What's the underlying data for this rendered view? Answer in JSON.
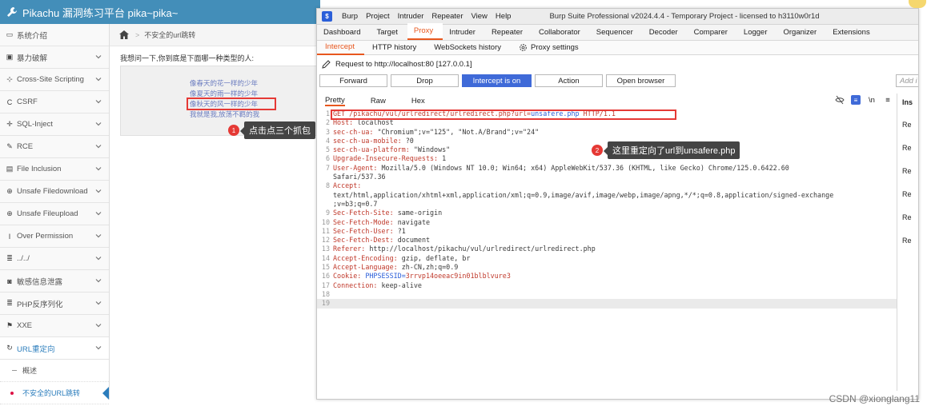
{
  "pikachu": {
    "app_title": "Pikachu 漏洞练习平台 pika~pika~",
    "breadcrumb": "不安全的url跳转",
    "question": "我想问一下,你到底是下面哪一种类型的人:",
    "links": [
      "像春天的花一样的少年",
      "像夏天的雨一样的少年",
      "像秋天的风一样的少年",
      "我就是我,放荡不羁的我"
    ],
    "sidebar": [
      {
        "label": "系统介绍",
        "icon": "desktop-icon"
      },
      {
        "label": "暴力破解",
        "icon": "lock-icon"
      },
      {
        "label": "Cross-Site Scripting",
        "icon": "code-icon"
      },
      {
        "label": "CSRF",
        "icon": "csrf-icon"
      },
      {
        "label": "SQL-Inject",
        "icon": "syringe-icon"
      },
      {
        "label": "RCE",
        "icon": "pencil-icon"
      },
      {
        "label": "File Inclusion",
        "icon": "file-icon"
      },
      {
        "label": "Unsafe Filedownload",
        "icon": "download-icon"
      },
      {
        "label": "Unsafe Fileupload",
        "icon": "upload-icon"
      },
      {
        "label": "Over Permission",
        "icon": "cursor-icon"
      },
      {
        "label": "../../",
        "icon": "list-icon"
      },
      {
        "label": "敏感信息泄露",
        "icon": "camera-icon"
      },
      {
        "label": "PHP反序列化",
        "icon": "list-icon"
      },
      {
        "label": "XXE",
        "icon": "flag-icon"
      },
      {
        "label": "URL重定向",
        "icon": "redirect-icon"
      }
    ],
    "sub_items": [
      "概述",
      "不安全的URL跳转"
    ]
  },
  "callouts": {
    "one_num": "1",
    "one_text": "点击点三个抓包",
    "two_num": "2",
    "two_text": "这里重定向了url到unsafere.php"
  },
  "burp": {
    "menu": [
      "Burp",
      "Project",
      "Intruder",
      "Repeater",
      "View",
      "Help"
    ],
    "window_title": "Burp Suite Professional v2024.4.4 - Temporary Project - licensed to h3110w0r1d",
    "main_tabs": [
      "Dashboard",
      "Target",
      "Proxy",
      "Intruder",
      "Repeater",
      "Collaborator",
      "Sequencer",
      "Decoder",
      "Comparer",
      "Logger",
      "Organizer",
      "Extensions"
    ],
    "selected_main_tab": "Proxy",
    "sub_tabs": [
      "Intercept",
      "HTTP history",
      "WebSockets history",
      "Proxy settings"
    ],
    "request_line": "Request to http://localhost:80  [127.0.0.1]",
    "buttons": {
      "forward": "Forward",
      "drop": "Drop",
      "intercept": "Intercept is on",
      "action": "Action",
      "open_browser": "Open browser",
      "add": "Add i"
    },
    "views": [
      "Pretty",
      "Raw",
      "Hex"
    ],
    "inspector_title": "Ins",
    "inspector_rows": [
      "Re",
      "Re",
      "Re",
      "Re",
      "Re",
      "Re"
    ],
    "request_lines": [
      {
        "n": "1",
        "parts": [
          [
            "GET /pikachu/vul/urlredirect/urlredirect.php?url=",
            "h"
          ],
          [
            "unsafere.php",
            "b"
          ],
          [
            " HTTP/1.1",
            "h"
          ]
        ]
      },
      {
        "n": "2",
        "parts": [
          [
            "Host: ",
            "h"
          ],
          [
            "localhost",
            "v"
          ]
        ]
      },
      {
        "n": "3",
        "parts": [
          [
            "sec-ch-ua: ",
            "h"
          ],
          [
            "\"Chromium\";v=\"125\", \"Not.A/Brand\";v=\"24\"",
            "v"
          ]
        ]
      },
      {
        "n": "4",
        "parts": [
          [
            "sec-ch-ua-mobile: ",
            "h"
          ],
          [
            "?0",
            "v"
          ]
        ]
      },
      {
        "n": "5",
        "parts": [
          [
            "sec-ch-ua-platform: ",
            "h"
          ],
          [
            "\"Windows\"",
            "v"
          ]
        ]
      },
      {
        "n": "6",
        "parts": [
          [
            "Upgrade-Insecure-Requests: ",
            "h"
          ],
          [
            "1",
            "v"
          ]
        ]
      },
      {
        "n": "7",
        "parts": [
          [
            "User-Agent: ",
            "h"
          ],
          [
            "Mozilla/5.0 (Windows NT 10.0; Win64; x64) AppleWebKit/537.36 (KHTML, like Gecko) Chrome/125.0.6422.60",
            "v"
          ]
        ]
      },
      {
        "n": "",
        "parts": [
          [
            "Safari/537.36",
            "v"
          ]
        ]
      },
      {
        "n": "8",
        "parts": [
          [
            "Accept:",
            "h"
          ]
        ]
      },
      {
        "n": "",
        "parts": [
          [
            "text/html,application/xhtml+xml,application/xml;q=0.9,image/avif,image/webp,image/apng,*/*;q=0.8,application/signed-exchange",
            "v"
          ]
        ]
      },
      {
        "n": "",
        "parts": [
          [
            ";v=b3;q=0.7",
            "v"
          ]
        ]
      },
      {
        "n": "9",
        "parts": [
          [
            "Sec-Fetch-Site: ",
            "h"
          ],
          [
            "same-origin",
            "v"
          ]
        ]
      },
      {
        "n": "10",
        "parts": [
          [
            "Sec-Fetch-Mode: ",
            "h"
          ],
          [
            "navigate",
            "v"
          ]
        ]
      },
      {
        "n": "11",
        "parts": [
          [
            "Sec-Fetch-User: ",
            "h"
          ],
          [
            "?1",
            "v"
          ]
        ]
      },
      {
        "n": "12",
        "parts": [
          [
            "Sec-Fetch-Dest: ",
            "h"
          ],
          [
            "document",
            "v"
          ]
        ]
      },
      {
        "n": "13",
        "parts": [
          [
            "Referer: ",
            "h"
          ],
          [
            "http://localhost/pikachu/vul/urlredirect/urlredirect.php",
            "v"
          ]
        ]
      },
      {
        "n": "14",
        "parts": [
          [
            "Accept-Encoding: ",
            "h"
          ],
          [
            "gzip, deflate, br",
            "v"
          ]
        ]
      },
      {
        "n": "15",
        "parts": [
          [
            "Accept-Language: ",
            "h"
          ],
          [
            "zh-CN,zh;q=0.9",
            "v"
          ]
        ]
      },
      {
        "n": "16",
        "parts": [
          [
            "Cookie: ",
            "h"
          ],
          [
            "PHPSESSID=",
            "b"
          ],
          [
            "3rrvp14oeeac9in01blblvure3",
            "r"
          ]
        ]
      },
      {
        "n": "17",
        "parts": [
          [
            "Connection: ",
            "h"
          ],
          [
            "keep-alive",
            "v"
          ]
        ]
      },
      {
        "n": "18",
        "parts": []
      },
      {
        "n": "19",
        "parts": [],
        "cur": true
      }
    ]
  },
  "watermark": "CSDN @xionglang11"
}
